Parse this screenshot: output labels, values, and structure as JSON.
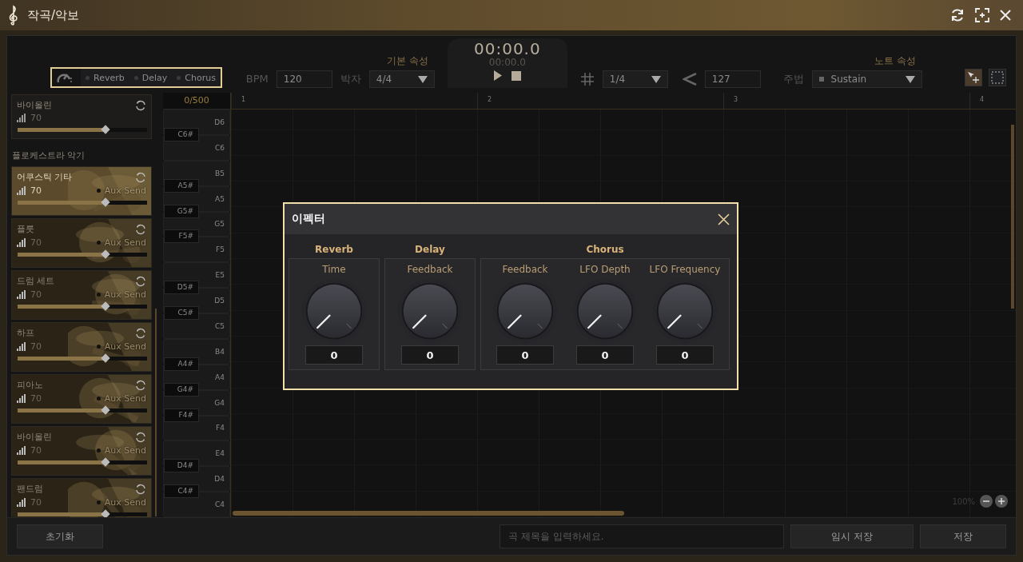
{
  "window": {
    "title": "작곡/악보"
  },
  "effects_bar": {
    "items": [
      {
        "label": "Reverb"
      },
      {
        "label": "Delay"
      },
      {
        "label": "Chorus"
      }
    ]
  },
  "toolbar": {
    "bpm_label": "BPM",
    "bpm": "120",
    "basic_header": "기본 속성",
    "meter_label": "박자",
    "meter": "4/4",
    "time": "00:00.0",
    "time_small": "00:00.0",
    "note_header": "노트 속성",
    "note_length": "1/4",
    "velocity": "127",
    "articulation_label": "주법",
    "articulation": "Sustain"
  },
  "sidebar": {
    "top_item": {
      "name": "바이올린",
      "volume": "70",
      "level": 0.68
    },
    "section_title": "플로케스트라 악기",
    "items": [
      {
        "name": "어쿠스틱 기타",
        "volume": "70",
        "level": 0.68,
        "aux": "Aux Send",
        "selected": true
      },
      {
        "name": "플룻",
        "volume": "70",
        "level": 0.68,
        "aux": "Aux Send",
        "selected": false
      },
      {
        "name": "드럼 세트",
        "volume": "70",
        "level": 0.68,
        "aux": "Aux Send",
        "selected": false
      },
      {
        "name": "하프",
        "volume": "70",
        "level": 0.68,
        "aux": "Aux Send",
        "selected": false
      },
      {
        "name": "피아노",
        "volume": "70",
        "level": 0.68,
        "aux": "Aux Send",
        "selected": false
      },
      {
        "name": "바이올린",
        "volume": "70",
        "level": 0.68,
        "aux": "Aux Send",
        "selected": false
      },
      {
        "name": "팬드럼",
        "volume": "70",
        "level": 0.68,
        "aux": "Aux Send",
        "selected": false
      }
    ]
  },
  "note_counter": "0/500",
  "ruler": [
    "1",
    "2",
    "3",
    "4"
  ],
  "keys": [
    {
      "note": "D6"
    },
    {
      "note": "C6",
      "sharp": "C6#"
    },
    {
      "note": "B5"
    },
    {
      "note": "A5",
      "sharp": "A5#"
    },
    {
      "note": "G5",
      "sharp": "G5#"
    },
    {
      "note": "F5",
      "sharp": "F5#"
    },
    {
      "note": "E5"
    },
    {
      "note": "D5",
      "sharp": "D5#"
    },
    {
      "note": "C5",
      "sharp": "C5#"
    },
    {
      "note": "B4"
    },
    {
      "note": "A4",
      "sharp": "A4#"
    },
    {
      "note": "G4",
      "sharp": "G4#"
    },
    {
      "note": "F4",
      "sharp": "F4#"
    },
    {
      "note": "E4"
    },
    {
      "note": "D4",
      "sharp": "D4#"
    },
    {
      "note": "C4",
      "sharp": "C4#"
    }
  ],
  "zoom": {
    "text": "100%"
  },
  "bottom_bar": {
    "reset": "초기화",
    "title_placeholder": "곡 제목을 입력하세요.",
    "temp_save": "임시 저장",
    "save": "저장"
  },
  "dialog": {
    "title": "이펙터",
    "groups": [
      {
        "name": "Reverb",
        "knobs": [
          {
            "label": "Time",
            "value": "0"
          }
        ]
      },
      {
        "name": "Delay",
        "knobs": [
          {
            "label": "Feedback",
            "value": "0"
          }
        ]
      },
      {
        "name": "Chorus",
        "knobs": [
          {
            "label": "Feedback",
            "value": "0"
          },
          {
            "label": "LFO Depth",
            "value": "0"
          },
          {
            "label": "LFO Frequency",
            "value": "0"
          }
        ]
      }
    ]
  }
}
